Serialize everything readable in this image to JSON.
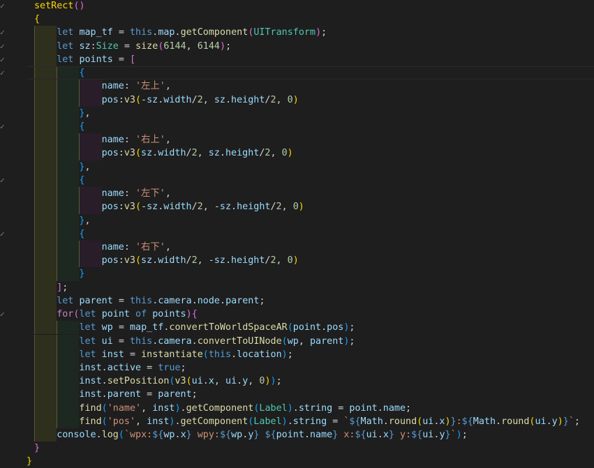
{
  "editor": {
    "lines": [
      [
        [
          "p1",
          "setRect"
        ],
        [
          "p2",
          "()"
        ]
      ],
      [
        [
          "p1",
          "{"
        ]
      ],
      [
        [
          "kw",
          "let "
        ],
        [
          "var",
          "map_tf"
        ],
        [
          "txt",
          " = "
        ],
        [
          "kw",
          "this"
        ],
        [
          "txt",
          "."
        ],
        [
          "var",
          "map"
        ],
        [
          "txt",
          "."
        ],
        [
          "fn",
          "getComponent"
        ],
        [
          "p2",
          "("
        ],
        [
          "type",
          "UITransform"
        ],
        [
          "p2",
          ")"
        ],
        [
          "txt",
          ";"
        ]
      ],
      [
        [
          "kw",
          "let "
        ],
        [
          "var",
          "sz"
        ],
        [
          "txt",
          ":"
        ],
        [
          "type",
          "Size"
        ],
        [
          "txt",
          " = "
        ],
        [
          "fn",
          "size"
        ],
        [
          "p2",
          "("
        ],
        [
          "num",
          "6144"
        ],
        [
          "txt",
          ", "
        ],
        [
          "num",
          "6144"
        ],
        [
          "p2",
          ")"
        ],
        [
          "txt",
          ";"
        ]
      ],
      [
        [
          "kw",
          "let "
        ],
        [
          "var",
          "points"
        ],
        [
          "txt",
          " = "
        ],
        [
          "p2",
          "["
        ]
      ],
      [
        [
          "p3",
          "{"
        ]
      ],
      [
        [
          "var",
          "name"
        ],
        [
          "txt",
          ": "
        ],
        [
          "str",
          "'左上'"
        ],
        [
          "txt",
          ","
        ]
      ],
      [
        [
          "var",
          "pos"
        ],
        [
          "txt",
          ":"
        ],
        [
          "fn",
          "v3"
        ],
        [
          "p1",
          "("
        ],
        [
          "txt",
          "-"
        ],
        [
          "var",
          "sz"
        ],
        [
          "txt",
          "."
        ],
        [
          "var",
          "width"
        ],
        [
          "txt",
          "/"
        ],
        [
          "num",
          "2"
        ],
        [
          "txt",
          ", "
        ],
        [
          "var",
          "sz"
        ],
        [
          "txt",
          "."
        ],
        [
          "var",
          "height"
        ],
        [
          "txt",
          "/"
        ],
        [
          "num",
          "2"
        ],
        [
          "txt",
          ", "
        ],
        [
          "num",
          "0"
        ],
        [
          "p1",
          ")"
        ]
      ],
      [
        [
          "p3",
          "}"
        ],
        [
          "txt",
          ","
        ]
      ],
      [
        [
          "p3",
          "{"
        ]
      ],
      [
        [
          "var",
          "name"
        ],
        [
          "txt",
          ": "
        ],
        [
          "str",
          "'右上'"
        ],
        [
          "txt",
          ","
        ]
      ],
      [
        [
          "var",
          "pos"
        ],
        [
          "txt",
          ":"
        ],
        [
          "fn",
          "v3"
        ],
        [
          "p1",
          "("
        ],
        [
          "var",
          "sz"
        ],
        [
          "txt",
          "."
        ],
        [
          "var",
          "width"
        ],
        [
          "txt",
          "/"
        ],
        [
          "num",
          "2"
        ],
        [
          "txt",
          ", "
        ],
        [
          "var",
          "sz"
        ],
        [
          "txt",
          "."
        ],
        [
          "var",
          "height"
        ],
        [
          "txt",
          "/"
        ],
        [
          "num",
          "2"
        ],
        [
          "txt",
          ", "
        ],
        [
          "num",
          "0"
        ],
        [
          "p1",
          ")"
        ]
      ],
      [
        [
          "p3",
          "}"
        ],
        [
          "txt",
          ","
        ]
      ],
      [
        [
          "p3",
          "{"
        ]
      ],
      [
        [
          "var",
          "name"
        ],
        [
          "txt",
          ": "
        ],
        [
          "str",
          "'左下'"
        ],
        [
          "txt",
          ","
        ]
      ],
      [
        [
          "var",
          "pos"
        ],
        [
          "txt",
          ":"
        ],
        [
          "fn",
          "v3"
        ],
        [
          "p1",
          "("
        ],
        [
          "txt",
          "-"
        ],
        [
          "var",
          "sz"
        ],
        [
          "txt",
          "."
        ],
        [
          "var",
          "width"
        ],
        [
          "txt",
          "/"
        ],
        [
          "num",
          "2"
        ],
        [
          "txt",
          ", -"
        ],
        [
          "var",
          "sz"
        ],
        [
          "txt",
          "."
        ],
        [
          "var",
          "height"
        ],
        [
          "txt",
          "/"
        ],
        [
          "num",
          "2"
        ],
        [
          "txt",
          ", "
        ],
        [
          "num",
          "0"
        ],
        [
          "p1",
          ")"
        ]
      ],
      [
        [
          "p3",
          "}"
        ],
        [
          "txt",
          ","
        ]
      ],
      [
        [
          "p3",
          "{"
        ]
      ],
      [
        [
          "var",
          "name"
        ],
        [
          "txt",
          ": "
        ],
        [
          "str",
          "'右下'"
        ],
        [
          "txt",
          ","
        ]
      ],
      [
        [
          "var",
          "pos"
        ],
        [
          "txt",
          ":"
        ],
        [
          "fn",
          "v3"
        ],
        [
          "p1",
          "("
        ],
        [
          "var",
          "sz"
        ],
        [
          "txt",
          "."
        ],
        [
          "var",
          "width"
        ],
        [
          "txt",
          "/"
        ],
        [
          "num",
          "2"
        ],
        [
          "txt",
          ", -"
        ],
        [
          "var",
          "sz"
        ],
        [
          "txt",
          "."
        ],
        [
          "var",
          "height"
        ],
        [
          "txt",
          "/"
        ],
        [
          "num",
          "2"
        ],
        [
          "txt",
          ", "
        ],
        [
          "num",
          "0"
        ],
        [
          "p1",
          ")"
        ]
      ],
      [
        [
          "p3",
          "}"
        ]
      ],
      [
        [
          "p2",
          "]"
        ],
        [
          "txt",
          ";"
        ]
      ],
      [
        [
          "kw",
          "let "
        ],
        [
          "var",
          "parent"
        ],
        [
          "txt",
          " = "
        ],
        [
          "kw",
          "this"
        ],
        [
          "txt",
          "."
        ],
        [
          "var",
          "camera"
        ],
        [
          "txt",
          "."
        ],
        [
          "var",
          "node"
        ],
        [
          "txt",
          "."
        ],
        [
          "var",
          "parent"
        ],
        [
          "txt",
          ";"
        ]
      ],
      [
        [
          "ctl",
          "for"
        ],
        [
          "p2",
          "("
        ],
        [
          "kw",
          "let "
        ],
        [
          "var",
          "point"
        ],
        [
          "kw",
          " of "
        ],
        [
          "var",
          "points"
        ],
        [
          "p2",
          ")"
        ],
        [
          "p2",
          "{"
        ]
      ],
      [
        [
          "kw",
          "let "
        ],
        [
          "var",
          "wp"
        ],
        [
          "txt",
          " = "
        ],
        [
          "var",
          "map_tf"
        ],
        [
          "txt",
          "."
        ],
        [
          "fn",
          "convertToWorldSpaceAR"
        ],
        [
          "p3",
          "("
        ],
        [
          "var",
          "point"
        ],
        [
          "txt",
          "."
        ],
        [
          "var",
          "pos"
        ],
        [
          "p3",
          ")"
        ],
        [
          "txt",
          ";"
        ]
      ],
      [
        [
          "kw",
          "let "
        ],
        [
          "var",
          "ui"
        ],
        [
          "txt",
          " = "
        ],
        [
          "kw",
          "this"
        ],
        [
          "txt",
          "."
        ],
        [
          "var",
          "camera"
        ],
        [
          "txt",
          "."
        ],
        [
          "fn",
          "convertToUINode"
        ],
        [
          "p3",
          "("
        ],
        [
          "var",
          "wp"
        ],
        [
          "txt",
          ", "
        ],
        [
          "var",
          "parent"
        ],
        [
          "p3",
          ")"
        ],
        [
          "txt",
          ";"
        ]
      ],
      [
        [
          "kw",
          "let "
        ],
        [
          "var",
          "inst"
        ],
        [
          "txt",
          " = "
        ],
        [
          "fn",
          "instantiate"
        ],
        [
          "p3",
          "("
        ],
        [
          "kw",
          "this"
        ],
        [
          "txt",
          "."
        ],
        [
          "var",
          "location"
        ],
        [
          "p3",
          ")"
        ],
        [
          "txt",
          ";"
        ]
      ],
      [
        [
          "var",
          "inst"
        ],
        [
          "txt",
          "."
        ],
        [
          "var",
          "active"
        ],
        [
          "txt",
          " = "
        ],
        [
          "kw",
          "true"
        ],
        [
          "txt",
          ";"
        ]
      ],
      [
        [
          "var",
          "inst"
        ],
        [
          "txt",
          "."
        ],
        [
          "fn",
          "setPosition"
        ],
        [
          "p3",
          "("
        ],
        [
          "fn",
          "v3"
        ],
        [
          "p1",
          "("
        ],
        [
          "var",
          "ui"
        ],
        [
          "txt",
          "."
        ],
        [
          "var",
          "x"
        ],
        [
          "txt",
          ", "
        ],
        [
          "var",
          "ui"
        ],
        [
          "txt",
          "."
        ],
        [
          "var",
          "y"
        ],
        [
          "txt",
          ", "
        ],
        [
          "num",
          "0"
        ],
        [
          "p1",
          ")"
        ],
        [
          "p3",
          ")"
        ],
        [
          "txt",
          ";"
        ]
      ],
      [
        [
          "var",
          "inst"
        ],
        [
          "txt",
          "."
        ],
        [
          "var",
          "parent"
        ],
        [
          "txt",
          " = "
        ],
        [
          "var",
          "parent"
        ],
        [
          "txt",
          ";"
        ]
      ],
      [
        [
          "fn",
          "find"
        ],
        [
          "p3",
          "("
        ],
        [
          "str",
          "'name'"
        ],
        [
          "txt",
          ", "
        ],
        [
          "var",
          "inst"
        ],
        [
          "p3",
          ")"
        ],
        [
          "txt",
          "."
        ],
        [
          "fn",
          "getComponent"
        ],
        [
          "p3",
          "("
        ],
        [
          "type",
          "Label"
        ],
        [
          "p3",
          ")"
        ],
        [
          "txt",
          "."
        ],
        [
          "var",
          "string"
        ],
        [
          "txt",
          " = "
        ],
        [
          "var",
          "point"
        ],
        [
          "txt",
          "."
        ],
        [
          "var",
          "name"
        ],
        [
          "txt",
          ";"
        ]
      ],
      [
        [
          "fn",
          "find"
        ],
        [
          "p3",
          "("
        ],
        [
          "str",
          "'pos'"
        ],
        [
          "txt",
          ", "
        ],
        [
          "var",
          "inst"
        ],
        [
          "p3",
          ")"
        ],
        [
          "txt",
          "."
        ],
        [
          "fn",
          "getComponent"
        ],
        [
          "p3",
          "("
        ],
        [
          "type",
          "Label"
        ],
        [
          "p3",
          ")"
        ],
        [
          "txt",
          "."
        ],
        [
          "var",
          "string"
        ],
        [
          "txt",
          " = "
        ],
        [
          "str",
          "`"
        ],
        [
          "kw",
          "${"
        ],
        [
          "var",
          "Math"
        ],
        [
          "txt",
          "."
        ],
        [
          "fn",
          "round"
        ],
        [
          "p1",
          "("
        ],
        [
          "var",
          "ui"
        ],
        [
          "txt",
          "."
        ],
        [
          "var",
          "x"
        ],
        [
          "p1",
          ")"
        ],
        [
          "kw",
          "}"
        ],
        [
          "str",
          ":"
        ],
        [
          "kw",
          "${"
        ],
        [
          "var",
          "Math"
        ],
        [
          "txt",
          "."
        ],
        [
          "fn",
          "round"
        ],
        [
          "p1",
          "("
        ],
        [
          "var",
          "ui"
        ],
        [
          "txt",
          "."
        ],
        [
          "var",
          "y"
        ],
        [
          "p1",
          ")"
        ],
        [
          "kw",
          "}"
        ],
        [
          "str",
          "`"
        ],
        [
          "txt",
          ";"
        ]
      ],
      [
        [
          "var",
          "console"
        ],
        [
          "txt",
          "."
        ],
        [
          "fn",
          "log"
        ],
        [
          "p3",
          "("
        ],
        [
          "str",
          "`wpx:"
        ],
        [
          "kw",
          "${"
        ],
        [
          "var",
          "wp"
        ],
        [
          "txt",
          "."
        ],
        [
          "var",
          "x"
        ],
        [
          "kw",
          "}"
        ],
        [
          "str",
          " wpy:"
        ],
        [
          "kw",
          "${"
        ],
        [
          "var",
          "wp"
        ],
        [
          "txt",
          "."
        ],
        [
          "var",
          "y"
        ],
        [
          "kw",
          "}"
        ],
        [
          "str",
          " "
        ],
        [
          "kw",
          "${"
        ],
        [
          "var",
          "point"
        ],
        [
          "txt",
          "."
        ],
        [
          "var",
          "name"
        ],
        [
          "kw",
          "}"
        ],
        [
          "str",
          " x:"
        ],
        [
          "kw",
          "${"
        ],
        [
          "var",
          "ui"
        ],
        [
          "txt",
          "."
        ],
        [
          "var",
          "x"
        ],
        [
          "kw",
          "}"
        ],
        [
          "str",
          " y:"
        ],
        [
          "kw",
          "${"
        ],
        [
          "var",
          "ui"
        ],
        [
          "txt",
          "."
        ],
        [
          "var",
          "y"
        ],
        [
          "kw",
          "}"
        ],
        [
          "str",
          "`"
        ],
        [
          "p3",
          ")"
        ],
        [
          "txt",
          ";"
        ]
      ],
      [
        [
          "p2",
          "}"
        ]
      ],
      [
        [
          "p1",
          "}"
        ]
      ]
    ]
  },
  "colors": {
    "background": "#1e1e1e",
    "indent_guide_1": "#4a4a1e",
    "indent_guide_2": "#1e3a24",
    "indent_guide_3": "#3a1e3a",
    "indent_guide_4": "#1e2a3a"
  }
}
